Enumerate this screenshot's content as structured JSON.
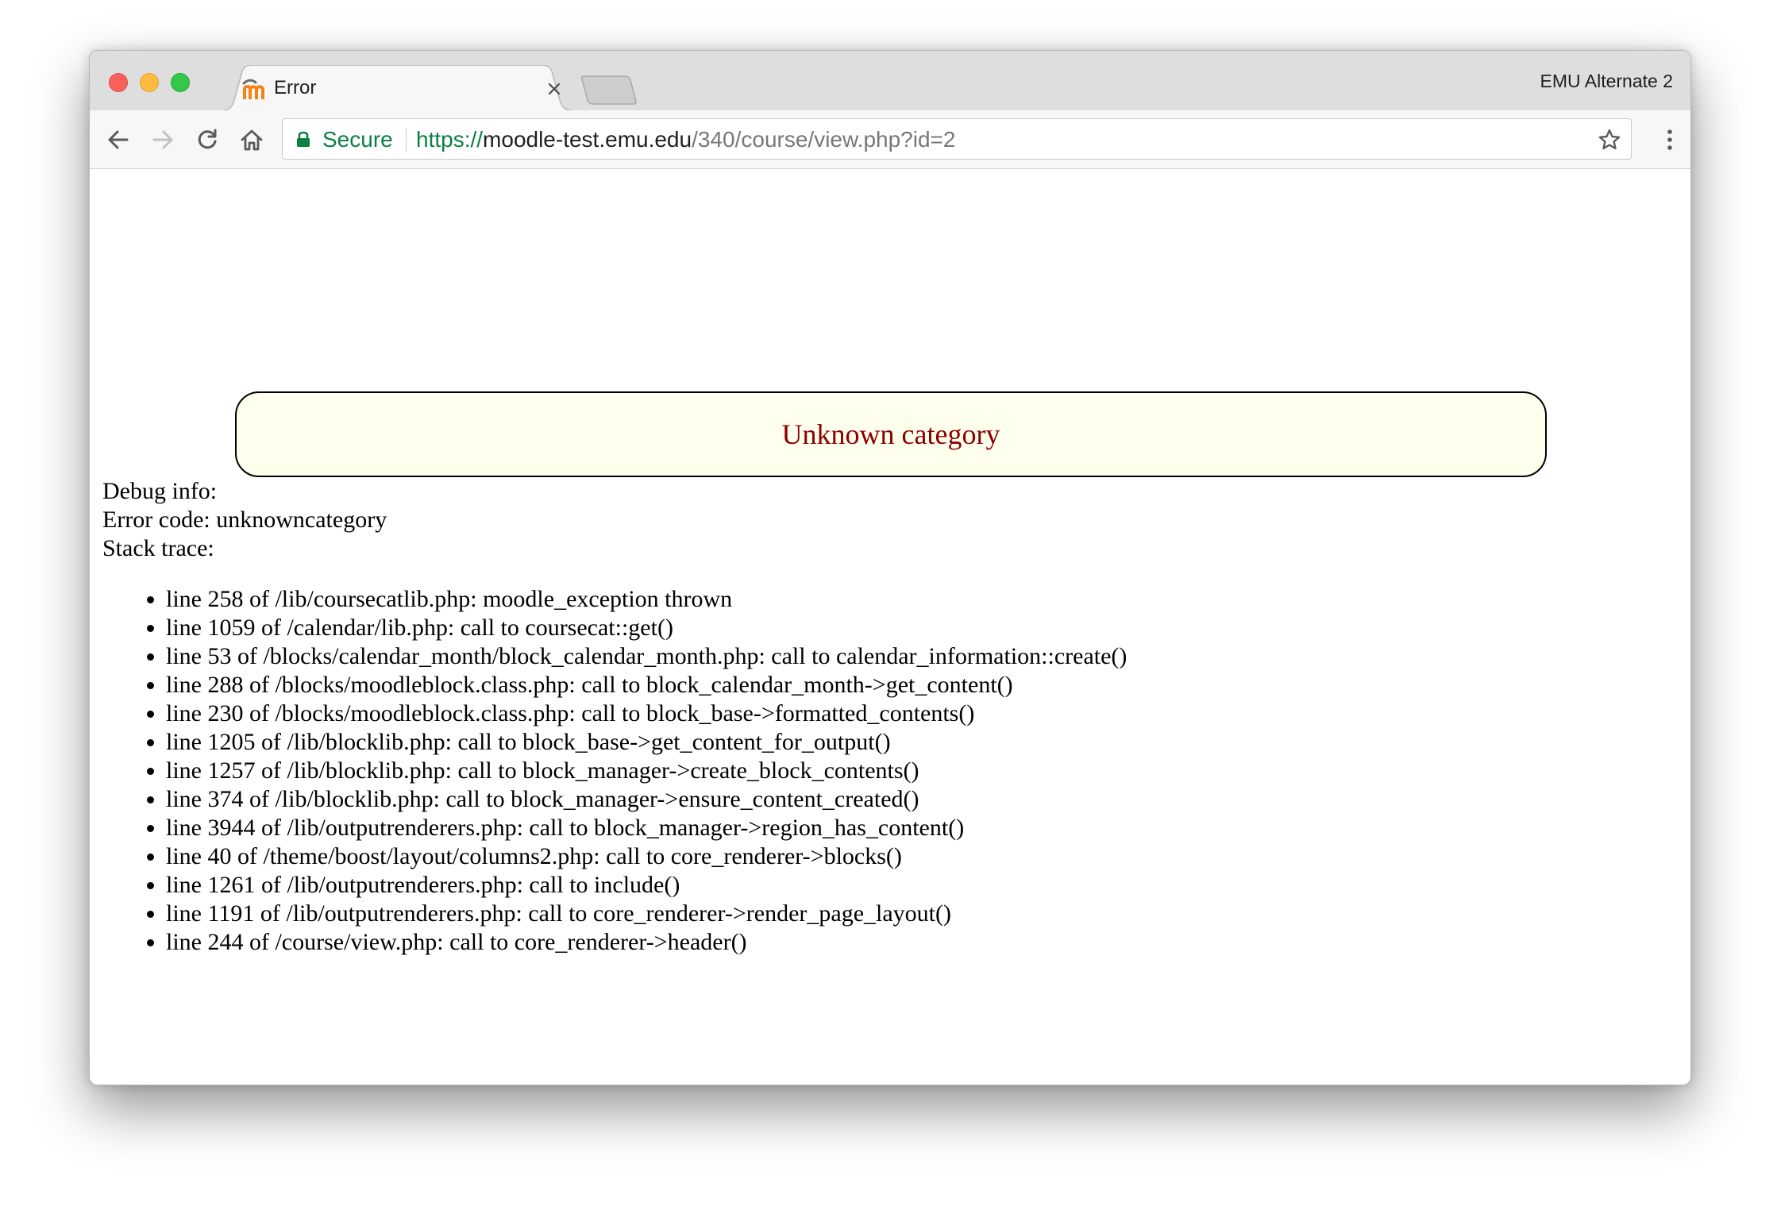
{
  "window": {
    "tab_title": "Error",
    "profile_name": "EMU Alternate 2"
  },
  "toolbar": {
    "secure_label": "Secure",
    "url_scheme": "https://",
    "url_host": "moodle-test.emu.edu",
    "url_path": "/340/course/view.php?id=2"
  },
  "icons": {
    "favicon": "moodle-m-icon",
    "back": "arrow-left-icon",
    "forward": "arrow-right-icon",
    "reload": "reload-icon",
    "home": "home-icon",
    "lock": "lock-icon",
    "bookmark": "star-icon",
    "menu": "kebab-menu-icon"
  },
  "colors": {
    "secure_green": "#0b8043",
    "error_text": "#8b0000",
    "error_box_bg": "#ffffee"
  },
  "page": {
    "error_message": "Unknown category",
    "debug_info": "Debug info:",
    "error_code": "Error code: unknowncategory",
    "stack_trace_label": "Stack trace:",
    "stack_trace": [
      "line 258 of /lib/coursecatlib.php: moodle_exception thrown",
      "line 1059 of /calendar/lib.php: call to coursecat::get()",
      "line 53 of /blocks/calendar_month/block_calendar_month.php: call to calendar_information::create()",
      "line 288 of /blocks/moodleblock.class.php: call to block_calendar_month->get_content()",
      "line 230 of /blocks/moodleblock.class.php: call to block_base->formatted_contents()",
      "line 1205 of /lib/blocklib.php: call to block_base->get_content_for_output()",
      "line 1257 of /lib/blocklib.php: call to block_manager->create_block_contents()",
      "line 374 of /lib/blocklib.php: call to block_manager->ensure_content_created()",
      "line 3944 of /lib/outputrenderers.php: call to block_manager->region_has_content()",
      "line 40 of /theme/boost/layout/columns2.php: call to core_renderer->blocks()",
      "line 1261 of /lib/outputrenderers.php: call to include()",
      "line 1191 of /lib/outputrenderers.php: call to core_renderer->render_page_layout()",
      "line 244 of /course/view.php: call to core_renderer->header()"
    ]
  }
}
